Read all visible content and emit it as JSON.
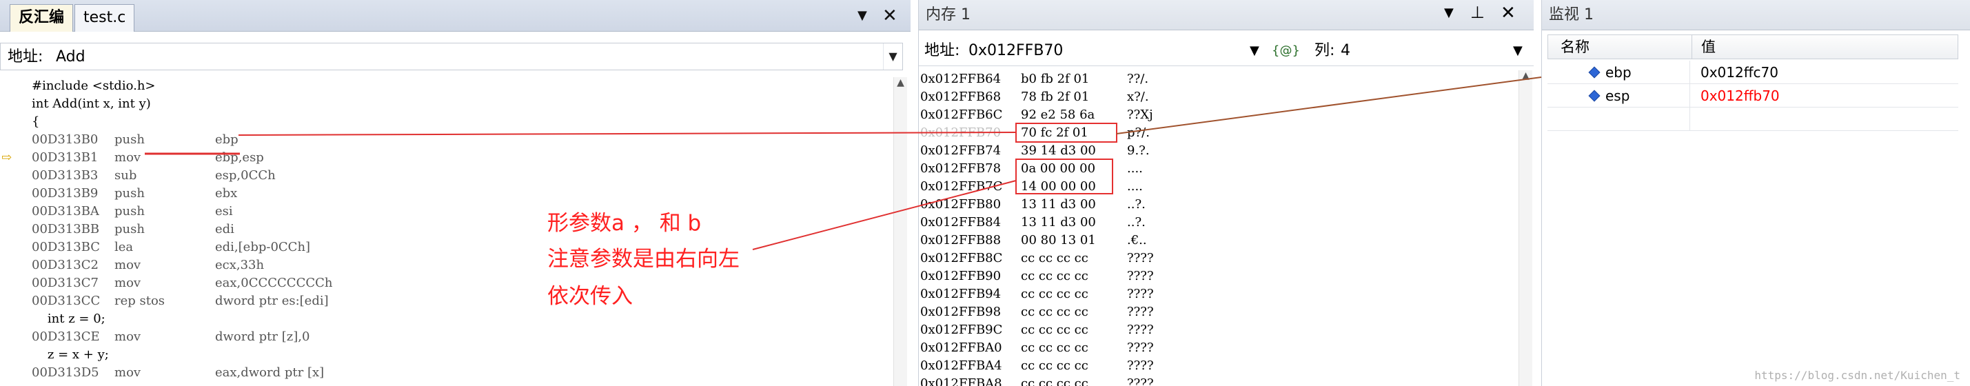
{
  "disasm": {
    "tabs": [
      {
        "label": "反汇编",
        "active": true
      },
      {
        "label": "test.c",
        "active": false
      }
    ],
    "address_label": "地址:",
    "address_value": "Add",
    "source_lines": [
      {
        "text": "#include <stdio.h>"
      },
      {
        "text": "int Add(int x, int y)"
      },
      {
        "text": "{"
      }
    ],
    "asm_lines": [
      {
        "addr": "00D313B0",
        "mnem": "push",
        "ops": "ebp"
      },
      {
        "addr": "00D313B1",
        "mnem": "mov",
        "ops": "ebp,esp",
        "current": true
      },
      {
        "addr": "00D313B3",
        "mnem": "sub",
        "ops": "esp,0CCh"
      },
      {
        "addr": "00D313B9",
        "mnem": "push",
        "ops": "ebx"
      },
      {
        "addr": "00D313BA",
        "mnem": "push",
        "ops": "esi"
      },
      {
        "addr": "00D313BB",
        "mnem": "push",
        "ops": "edi"
      },
      {
        "addr": "00D313BC",
        "mnem": "lea",
        "ops": "edi,[ebp-0CCh]"
      },
      {
        "addr": "00D313C2",
        "mnem": "mov",
        "ops": "ecx,33h"
      },
      {
        "addr": "00D313C7",
        "mnem": "mov",
        "ops": "eax,0CCCCCCCCh"
      },
      {
        "addr": "00D313CC",
        "mnem": "rep stos",
        "ops": "dword ptr es:[edi]"
      }
    ],
    "tail_lines": [
      {
        "kind": "src",
        "text": "    int z = 0;"
      },
      {
        "kind": "asm",
        "addr": "00D313CE",
        "mnem": "mov",
        "ops": "dword ptr [z],0"
      },
      {
        "kind": "src",
        "text": "    z = x + y;"
      },
      {
        "kind": "asm",
        "addr": "00D313D5",
        "mnem": "mov",
        "ops": "eax,dword ptr [x]"
      }
    ],
    "note_lines": [
      "形参数a ， 和 b",
      "注意参数是由右向左",
      "依次传入"
    ]
  },
  "memory": {
    "title": "内存 1",
    "address_label": "地址:",
    "address_value": "0x012FFB70",
    "columns_label": "列:",
    "columns_value": "4",
    "braces_icon_text": "{@}",
    "rows": [
      {
        "addr": "0x012FFB64",
        "bytes": "b0 fb 2f 01",
        "ascii": "??/."
      },
      {
        "addr": "0x012FFB68",
        "bytes": "78 fb 2f 01",
        "ascii": "x?/."
      },
      {
        "addr": "0x012FFB6C",
        "bytes": "92 e2 58 6a",
        "ascii": "??Xj"
      },
      {
        "addr": "0x012FFB70",
        "bytes": "70 fc 2f 01",
        "ascii": "p?/.",
        "dim": true
      },
      {
        "addr": "0x012FFB74",
        "bytes": "39 14 d3 00",
        "ascii": "9.?."
      },
      {
        "addr": "0x012FFB78",
        "bytes": "0a 00 00 00",
        "ascii": "...."
      },
      {
        "addr": "0x012FFB7C",
        "bytes": "14 00 00 00",
        "ascii": "...."
      },
      {
        "addr": "0x012FFB80",
        "bytes": "13 11 d3 00",
        "ascii": "..?."
      },
      {
        "addr": "0x012FFB84",
        "bytes": "13 11 d3 00",
        "ascii": "..?."
      },
      {
        "addr": "0x012FFB88",
        "bytes": "00 80 13 01",
        "ascii": ".€.."
      },
      {
        "addr": "0x012FFB8C",
        "bytes": "cc cc cc cc",
        "ascii": "????"
      },
      {
        "addr": "0x012FFB90",
        "bytes": "cc cc cc cc",
        "ascii": "????"
      },
      {
        "addr": "0x012FFB94",
        "bytes": "cc cc cc cc",
        "ascii": "????"
      },
      {
        "addr": "0x012FFB98",
        "bytes": "cc cc cc cc",
        "ascii": "????"
      },
      {
        "addr": "0x012FFB9C",
        "bytes": "cc cc cc cc",
        "ascii": "????"
      },
      {
        "addr": "0x012FFBA0",
        "bytes": "cc cc cc cc",
        "ascii": "????"
      },
      {
        "addr": "0x012FFBA4",
        "bytes": "cc cc cc cc",
        "ascii": "????"
      },
      {
        "addr": "0x012FFBA8",
        "bytes": "cc cc cc cc",
        "ascii": "????"
      }
    ]
  },
  "watch": {
    "title": "监视 1",
    "col_name": "名称",
    "col_value": "值",
    "rows": [
      {
        "name": "ebp",
        "value": "0x012ffc70",
        "value_color": "#000000"
      },
      {
        "name": "esp",
        "value": "0x012ffb70",
        "value_color": "#ff0000"
      }
    ]
  },
  "watermark": "https://blog.csdn.net/Kuichen_t",
  "colors": {
    "annotation": "#ff2020",
    "pointer_line": "#a0522d",
    "tab_active": "#fbf7e4"
  },
  "icons": {
    "close": "close-icon",
    "dropdown": "chevron-down-icon",
    "pin": "pin-icon",
    "current_line": "current-line-arrow-icon",
    "watch_var": "variable-icon"
  }
}
